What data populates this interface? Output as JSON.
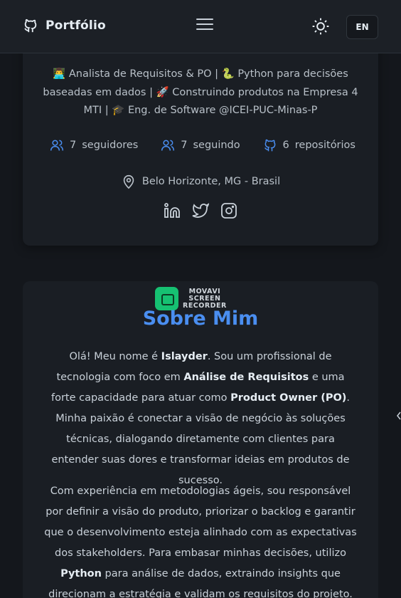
{
  "header": {
    "brand": "Portfólio",
    "lang": "EN"
  },
  "profile": {
    "bio_1": "👨‍💻 Analista de Requisitos & PO | 🐍 Python para decisões baseadas em dados | 🚀 Construindo produtos na Empresa 4 MTI | 🎓 Eng. de Software @ICEI-PUC-Minas-P",
    "followers_count": "7",
    "followers_label": "seguidores",
    "following_count": "7",
    "following_label": "seguindo",
    "repos_count": "6",
    "repos_label": "repositórios",
    "location": "Belo Horizonte, MG - Brasil"
  },
  "watermark": {
    "line1": "MOVAVI",
    "line2": "SCREEN",
    "line3": "RECORDER"
  },
  "about": {
    "title": "Sobre Mim",
    "p1_a": "Olá! Meu nome é ",
    "p1_name": "Islayder",
    "p1_b": ". Sou um profissional de tecnologia com foco em ",
    "p1_focus": "Análise de Requisitos",
    "p1_c": " e uma forte capacidade para atuar como ",
    "p1_role": "Product Owner (PO)",
    "p1_d": ". Minha paixão é conectar a visão de negócio às soluções técnicas, dialogando diretamente com clientes para entender suas dores e transformar ideias em produtos de sucesso.",
    "p2_a": "Com experiência em metodologias ágeis, sou responsável por definir a visão do produto, priorizar o backlog e garantir que o desenvolvimento esteja alinhado com as expectativas dos stakeholders. Para embasar minhas decisões, utilizo ",
    "p2_tool": "Python",
    "p2_b": " para análise de dados, extraindo insights que direcionam a estratégia e validam os requisitos do projeto."
  },
  "colors": {
    "accent": "#4a8ef0",
    "background": "#14171c",
    "card": "#1a1e24"
  }
}
